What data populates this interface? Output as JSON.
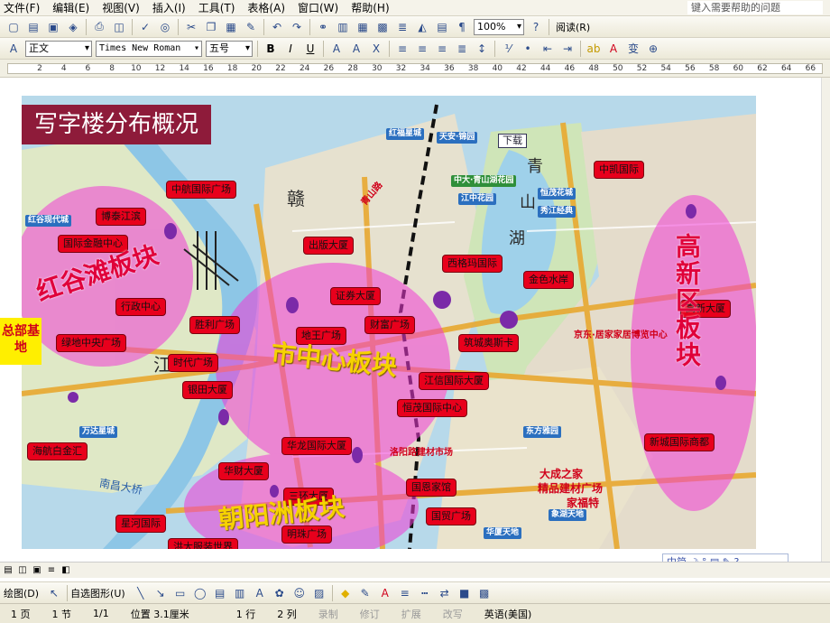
{
  "menu": {
    "items": [
      "文件(F)",
      "编辑(E)",
      "视图(V)",
      "插入(I)",
      "工具(T)",
      "表格(A)",
      "窗口(W)",
      "帮助(H)"
    ],
    "help_placeholder": "键入需要帮助的问题"
  },
  "toolbar": {
    "zoom": "100%",
    "read_mode": "阅读(R)"
  },
  "format_bar": {
    "style": "正文",
    "font": "Times New Roman",
    "size": "五号"
  },
  "ruler": {
    "numbers": [
      "2",
      "4",
      "6",
      "8",
      "10",
      "12",
      "14",
      "16",
      "18",
      "20",
      "22",
      "24",
      "26",
      "28",
      "30",
      "32",
      "34",
      "36",
      "38",
      "40",
      "42",
      "44",
      "46",
      "48",
      "50",
      "52",
      "54",
      "56",
      "58",
      "60",
      "62",
      "64",
      "66"
    ]
  },
  "map": {
    "title": "写字楼分布概况",
    "download": "下载",
    "hq": "总部基地",
    "zones": {
      "honggu": "红谷滩板块",
      "center": "市中心板块",
      "chaoyang": "朝阳洲板块",
      "gaoxin": "高新区板块"
    },
    "water": {
      "gan_left": "赣",
      "gan_right": "江",
      "qing": "青",
      "shan": "山",
      "hu": "湖"
    },
    "callouts": {
      "zhonghang": "中航国际广场",
      "bolan": "博泰江滨",
      "finance": "国际金融中心",
      "chuban": "出版大厦",
      "xingzheng": "行政中心",
      "zhengquan": "证券大厦",
      "shengli": "胜利广场",
      "caifu": "财富广场",
      "lvdi": "绿地中央广场",
      "diwang": "地王广场",
      "shidai": "时代广场",
      "yintian": "银田大厦",
      "jiangxin": "江信国际大厦",
      "hengmao": "恒茂国际中心",
      "haiyi": "海航白金汇",
      "huahui": "华财大厦",
      "hualong": "华龙国际大厦",
      "sanhuan": "三环大厦",
      "guomao": "国贸广场",
      "guoyuan": "国恩家馆",
      "xinghe": "星河国际",
      "hongda": "洪大服装世界",
      "mingzhu": "明珠广场",
      "zhongling": "中凯国际",
      "xige": "西格玛国际",
      "jinse": "金色水岸",
      "zhucheng": "筑城奥斯卡",
      "gaoxin_bld": "高新大厦",
      "xinchen": "新城国际商都"
    },
    "places": {
      "honggu_xian": "红谷现代城",
      "qingshanhu": "中大·青山湖花园",
      "jiangzhong": "江中花园",
      "hengmao": "恒茂花城",
      "huangyuan": "秀江经典",
      "tianan": "天安·锦园",
      "hongfu": "红福星城",
      "qingshan": "青山路",
      "wanda": "万达星城",
      "donghu": "东方雅园",
      "xianghu": "象湖天地",
      "huaxia": "华厦天地"
    },
    "ads": {
      "jiaju": "京东·居家家居博览中心",
      "dacheng": "大成之家",
      "jingpin": "精品建材广场",
      "luoyang": "洛阳路建材市场",
      "jiafute": "家福特"
    },
    "bridge": "南昌大桥"
  },
  "ime": {
    "label": "中简"
  },
  "drawbar": {
    "draw": "绘图(D)",
    "autoshape": "自选图形(U)"
  },
  "status": {
    "page": "1 页",
    "section": "1 节",
    "pages": "1/1",
    "position": "位置 3.1厘米",
    "line": "1 行",
    "column": "2 列",
    "rec": "录制",
    "trk": "修订",
    "ext": "扩展",
    "ovr": "改写",
    "lang": "英语(美国)"
  },
  "colors": {
    "title_bg": "#8e1b3a",
    "callout": "#e8001c",
    "zone_pink": "#f03ad6",
    "road": "#e8a830",
    "water": "#c9e3f0"
  }
}
